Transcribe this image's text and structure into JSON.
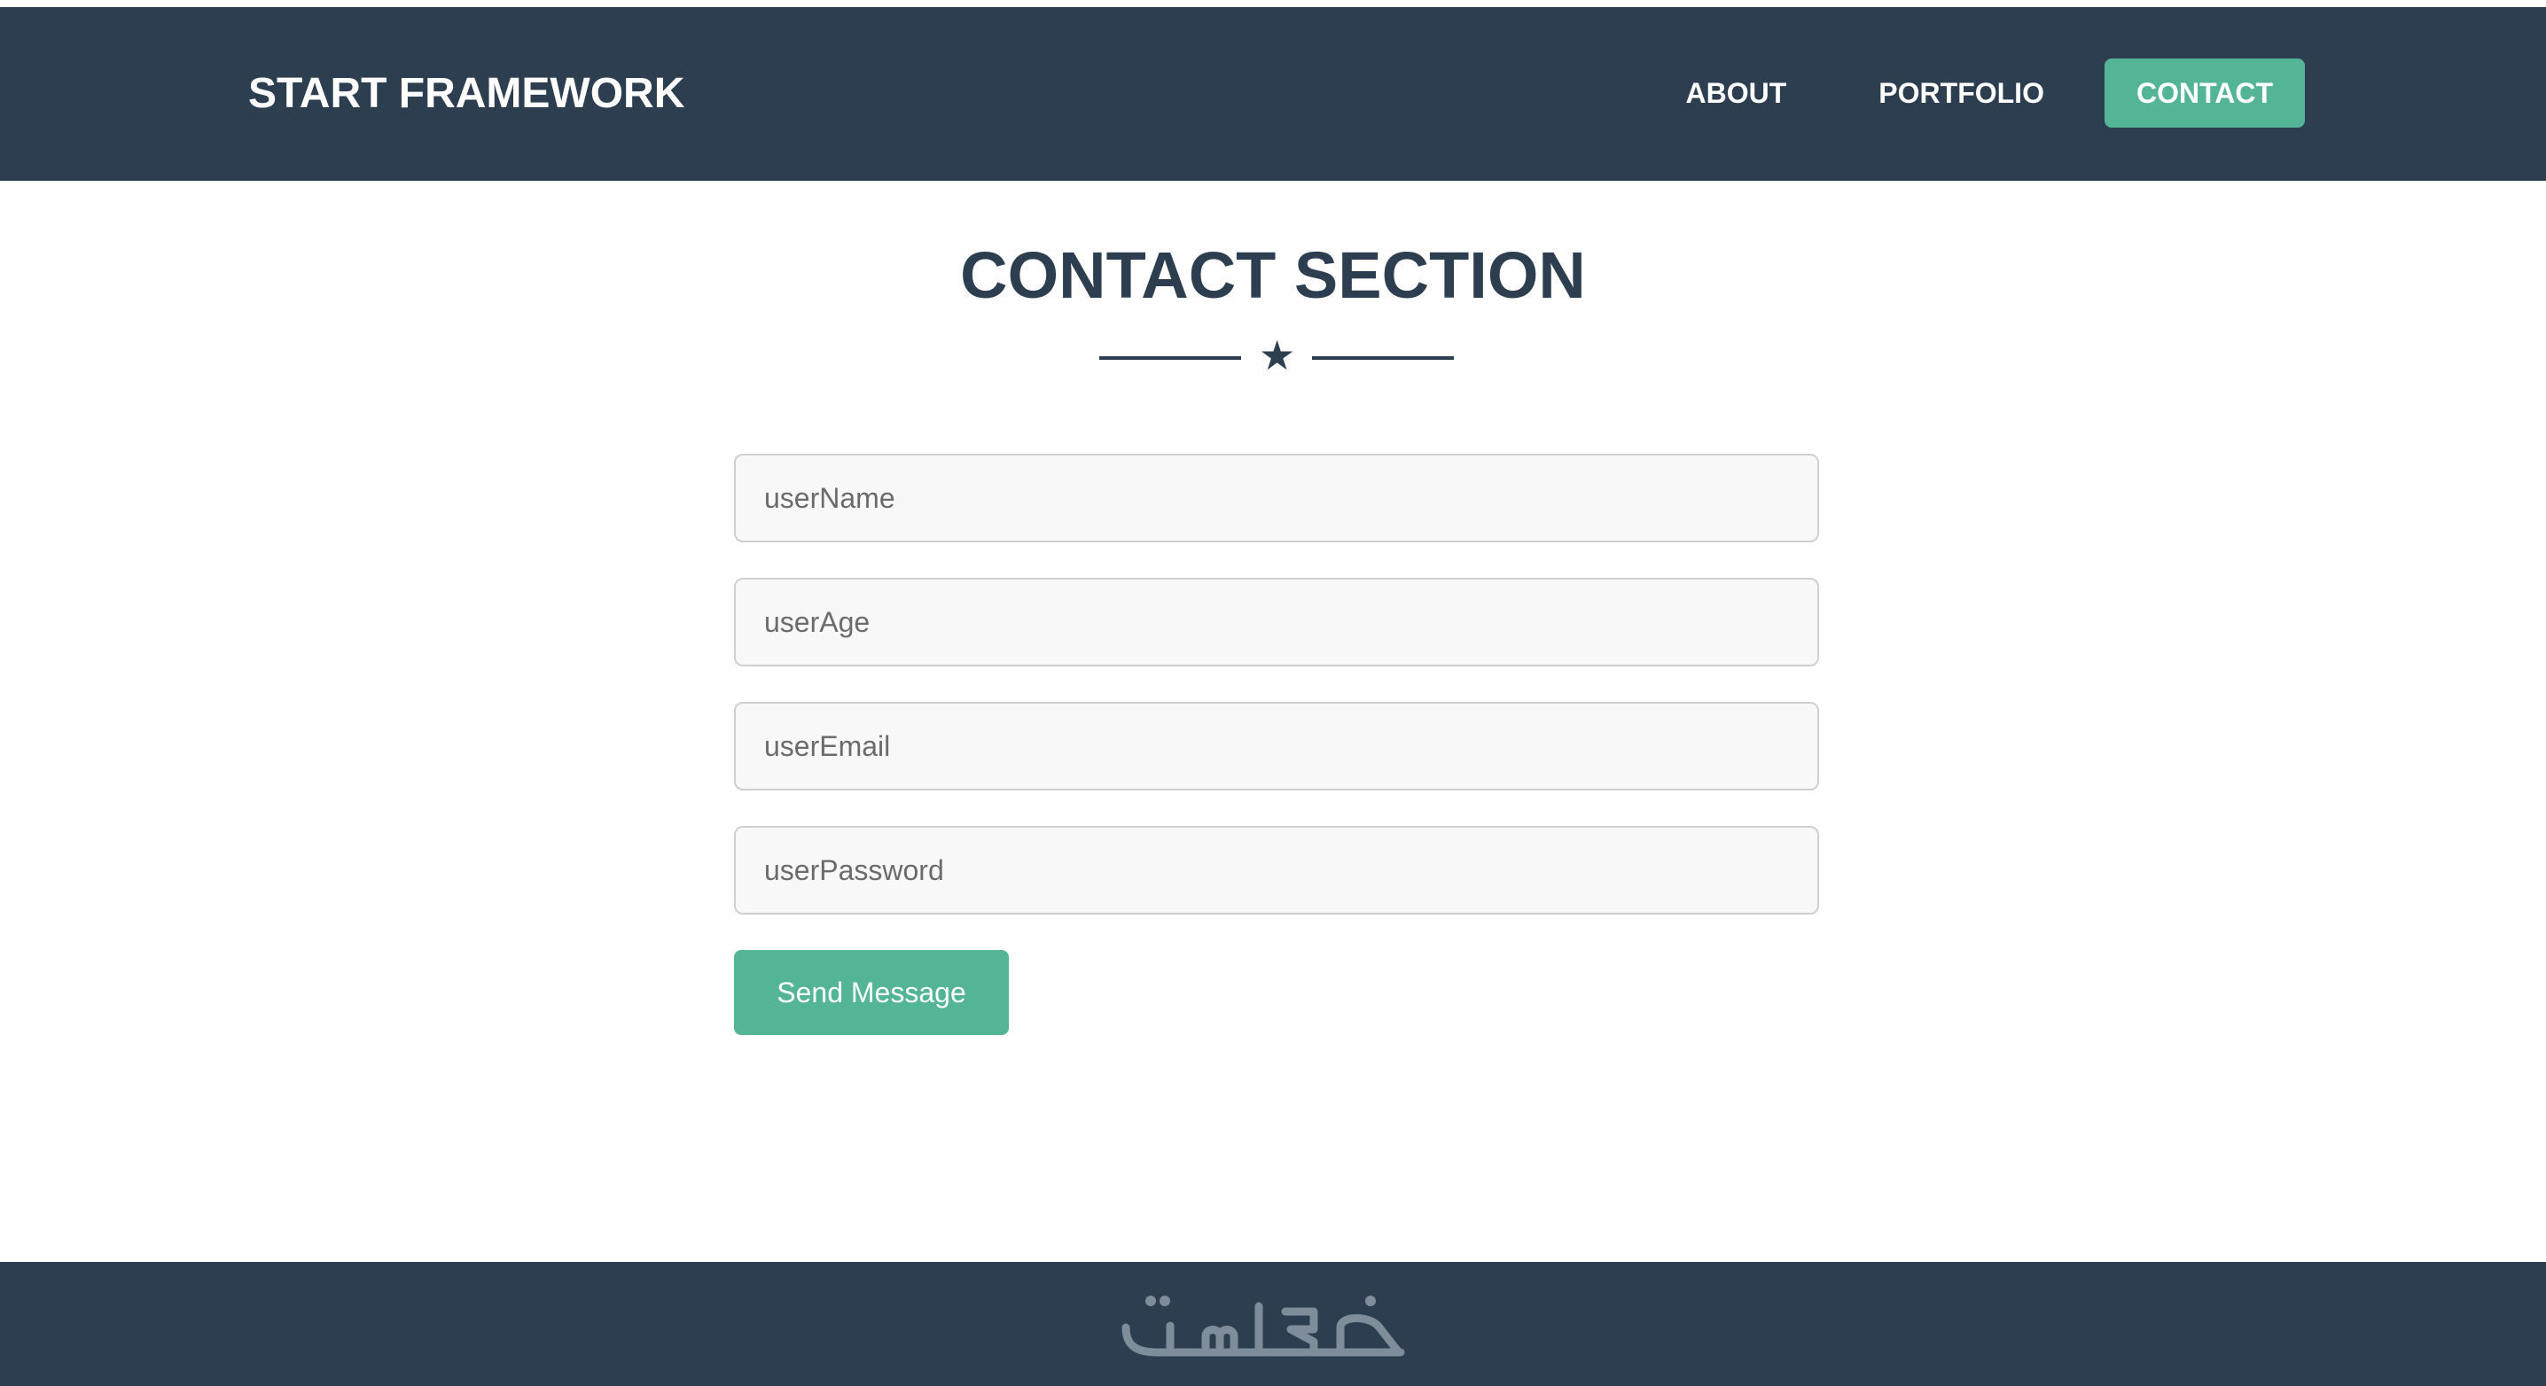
{
  "navbar": {
    "brand": "START FRAMEWORK",
    "links": [
      {
        "label": "ABOUT",
        "active": false
      },
      {
        "label": "PORTFOLIO",
        "active": false
      },
      {
        "label": "CONTACT",
        "active": true
      }
    ]
  },
  "contact": {
    "title": "CONTACT SECTION",
    "divider_icon": "star-icon",
    "fields": [
      {
        "placeholder": "userName",
        "value": ""
      },
      {
        "placeholder": "userAge",
        "value": ""
      },
      {
        "placeholder": "userEmail",
        "value": ""
      },
      {
        "placeholder": "userPassword",
        "value": ""
      }
    ],
    "submit_label": "Send Message"
  },
  "footer": {
    "logo": "خمسات"
  },
  "colors": {
    "navbar_bg": "#2c3e50",
    "accent": "#53b596",
    "text_dark": "#2c3e50"
  }
}
